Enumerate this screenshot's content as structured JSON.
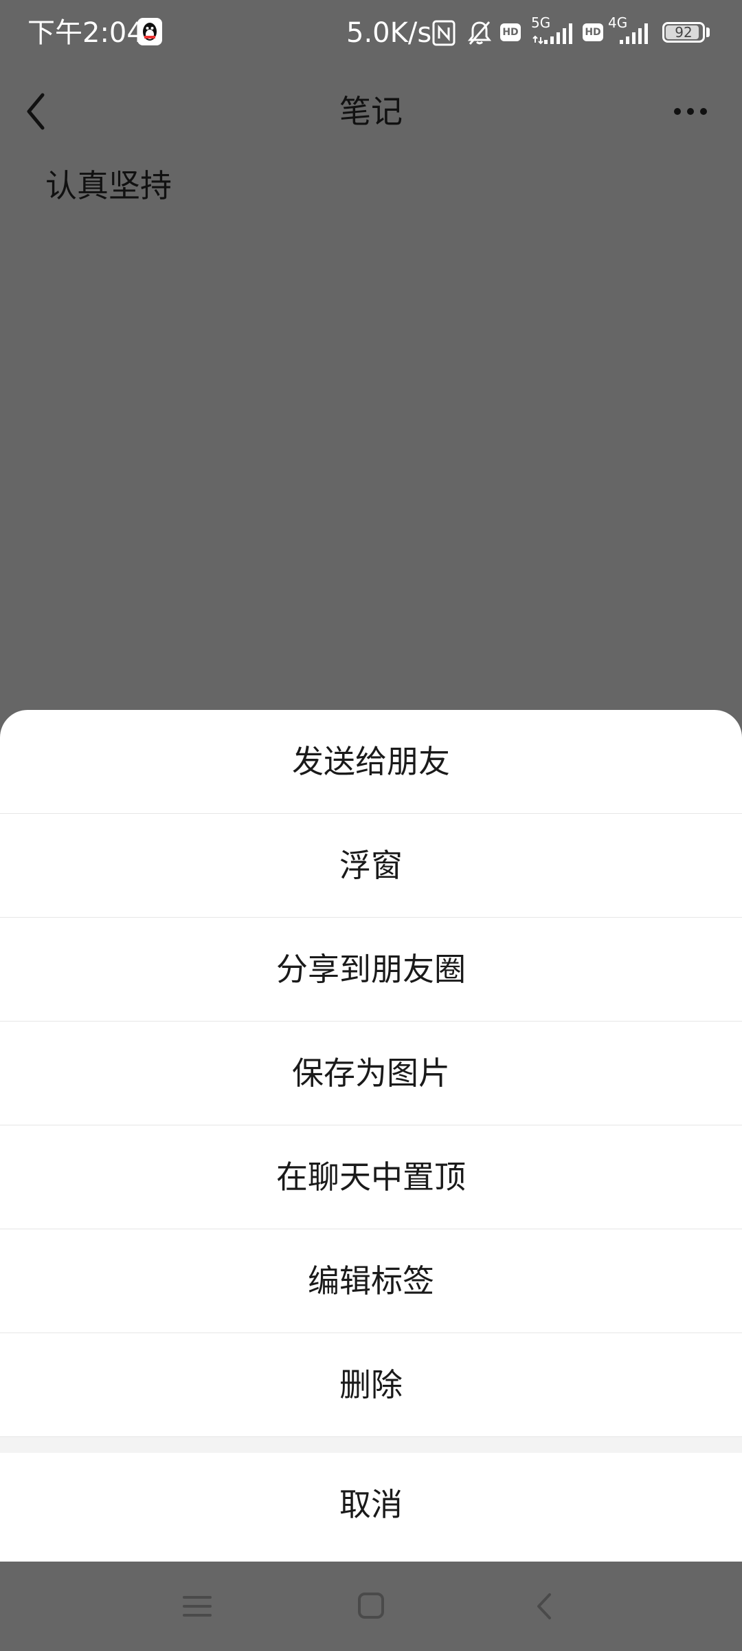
{
  "status_bar": {
    "time": "下午2:04",
    "net_speed": "5.0K/s",
    "network_5g": "5G",
    "network_4g": "4G",
    "hd_label": "HD",
    "battery_level": "92",
    "battery_fraction": 0.92
  },
  "header": {
    "title": "笔记"
  },
  "note": {
    "text": "认真坚持"
  },
  "action_sheet": {
    "items": [
      {
        "label": "发送给朋友"
      },
      {
        "label": "浮窗"
      },
      {
        "label": "分享到朋友圈"
      },
      {
        "label": "保存为图片"
      },
      {
        "label": "在聊天中置顶"
      },
      {
        "label": "编辑标签"
      },
      {
        "label": "删除"
      }
    ],
    "cancel_label": "取消"
  },
  "icons": {
    "back": "chevron-left-icon",
    "more": "more-dots-icon",
    "nav_menu": "menu-icon",
    "nav_home": "home-square-icon",
    "nav_back": "back-chevron-icon"
  },
  "colors": {
    "overlay": "#666666",
    "sheet_bg": "#ffffff",
    "divider": "#e6e6e6",
    "text": "#1a1a1a"
  }
}
